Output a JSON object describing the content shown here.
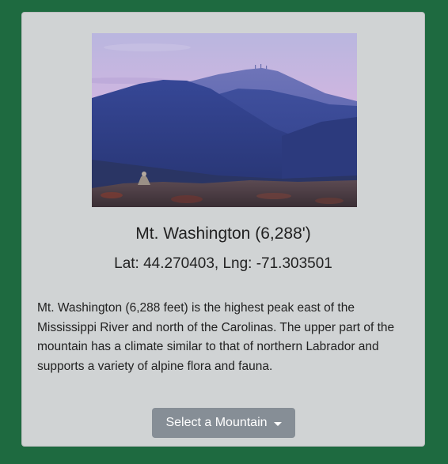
{
  "card": {
    "image_alt": "Mt. Washington",
    "title": "Mt. Washington (6,288')",
    "coordinates": "Lat: 44.270403, Lng: -71.303501",
    "description": "Mt. Washington (6,288 feet) is the highest peak east of the Mississippi River and north of the Carolinas. The upper part of the mountain has a climate similar to that of northern Labrador and supports a variety of alpine flora and fauna."
  },
  "dropdown": {
    "label": "Select a Mountain",
    "icon": "caret-down-icon"
  },
  "colors": {
    "page_background": "#1e6a40",
    "card_background": "#d0d3d4",
    "button_background": "#868e96"
  }
}
